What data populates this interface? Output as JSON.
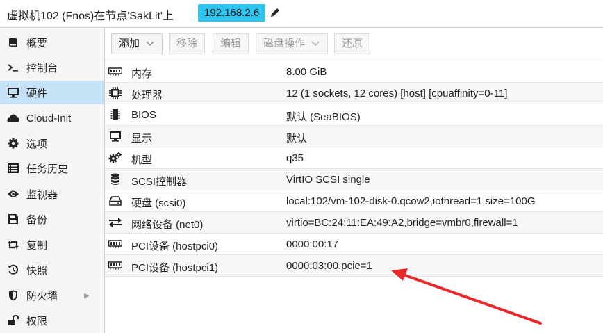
{
  "header": {
    "title": "虚拟机102 (Fnos)在节点'SakLit'上",
    "ip": "192.168.2.6",
    "edit_icon": "pencil-icon"
  },
  "sidebar": {
    "items": [
      {
        "label": "概要",
        "icon": "book-icon"
      },
      {
        "label": "控制台",
        "icon": "terminal-icon"
      },
      {
        "label": "硬件",
        "icon": "monitor-icon",
        "active": true
      },
      {
        "label": "Cloud-Init",
        "icon": "cloud-icon"
      },
      {
        "label": "选项",
        "icon": "gear-icon"
      },
      {
        "label": "任务历史",
        "icon": "list-icon"
      },
      {
        "label": "监视器",
        "icon": "eye-icon"
      },
      {
        "label": "备份",
        "icon": "floppy-icon"
      },
      {
        "label": "复制",
        "icon": "retweet-icon"
      },
      {
        "label": "快照",
        "icon": "history-icon"
      },
      {
        "label": "防火墙",
        "icon": "shield-icon",
        "has_submenu": true
      },
      {
        "label": "权限",
        "icon": "unlock-icon"
      }
    ]
  },
  "toolbar": {
    "add": "添加",
    "remove": "移除",
    "edit": "编辑",
    "disk_action": "磁盘操作",
    "revert": "还原"
  },
  "hardware": {
    "rows": [
      {
        "name": "内存",
        "value": "8.00 GiB",
        "icon": "memory-icon"
      },
      {
        "name": "处理器",
        "value": "12 (1 sockets, 12 cores) [host] [cpuaffinity=0-11]",
        "icon": "cpu-icon"
      },
      {
        "name": "BIOS",
        "value": "默认 (SeaBIOS)",
        "icon": "microchip-icon"
      },
      {
        "name": "显示",
        "value": "默认",
        "icon": "desktop-icon"
      },
      {
        "name": "机型",
        "value": "q35",
        "icon": "cogs-icon"
      },
      {
        "name": "SCSI控制器",
        "value": "VirtIO SCSI single",
        "icon": "database-icon"
      },
      {
        "name": "硬盘 (scsi0)",
        "value": "local:102/vm-102-disk-0.qcow2,iothread=1,size=100G",
        "icon": "hdd-icon"
      },
      {
        "name": "网络设备 (net0)",
        "value": "virtio=BC:24:11:EA:49:A2,bridge=vmbr0,firewall=1",
        "icon": "exchange-icon"
      },
      {
        "name": "PCI设备 (hostpci0)",
        "value": "0000:00:17",
        "icon": "pci-card-icon"
      },
      {
        "name": "PCI设备 (hostpci1)",
        "value": "0000:03:00,pcie=1",
        "icon": "pci-card-icon"
      }
    ]
  },
  "annotation": {
    "arrow_color": "#e8282b"
  }
}
